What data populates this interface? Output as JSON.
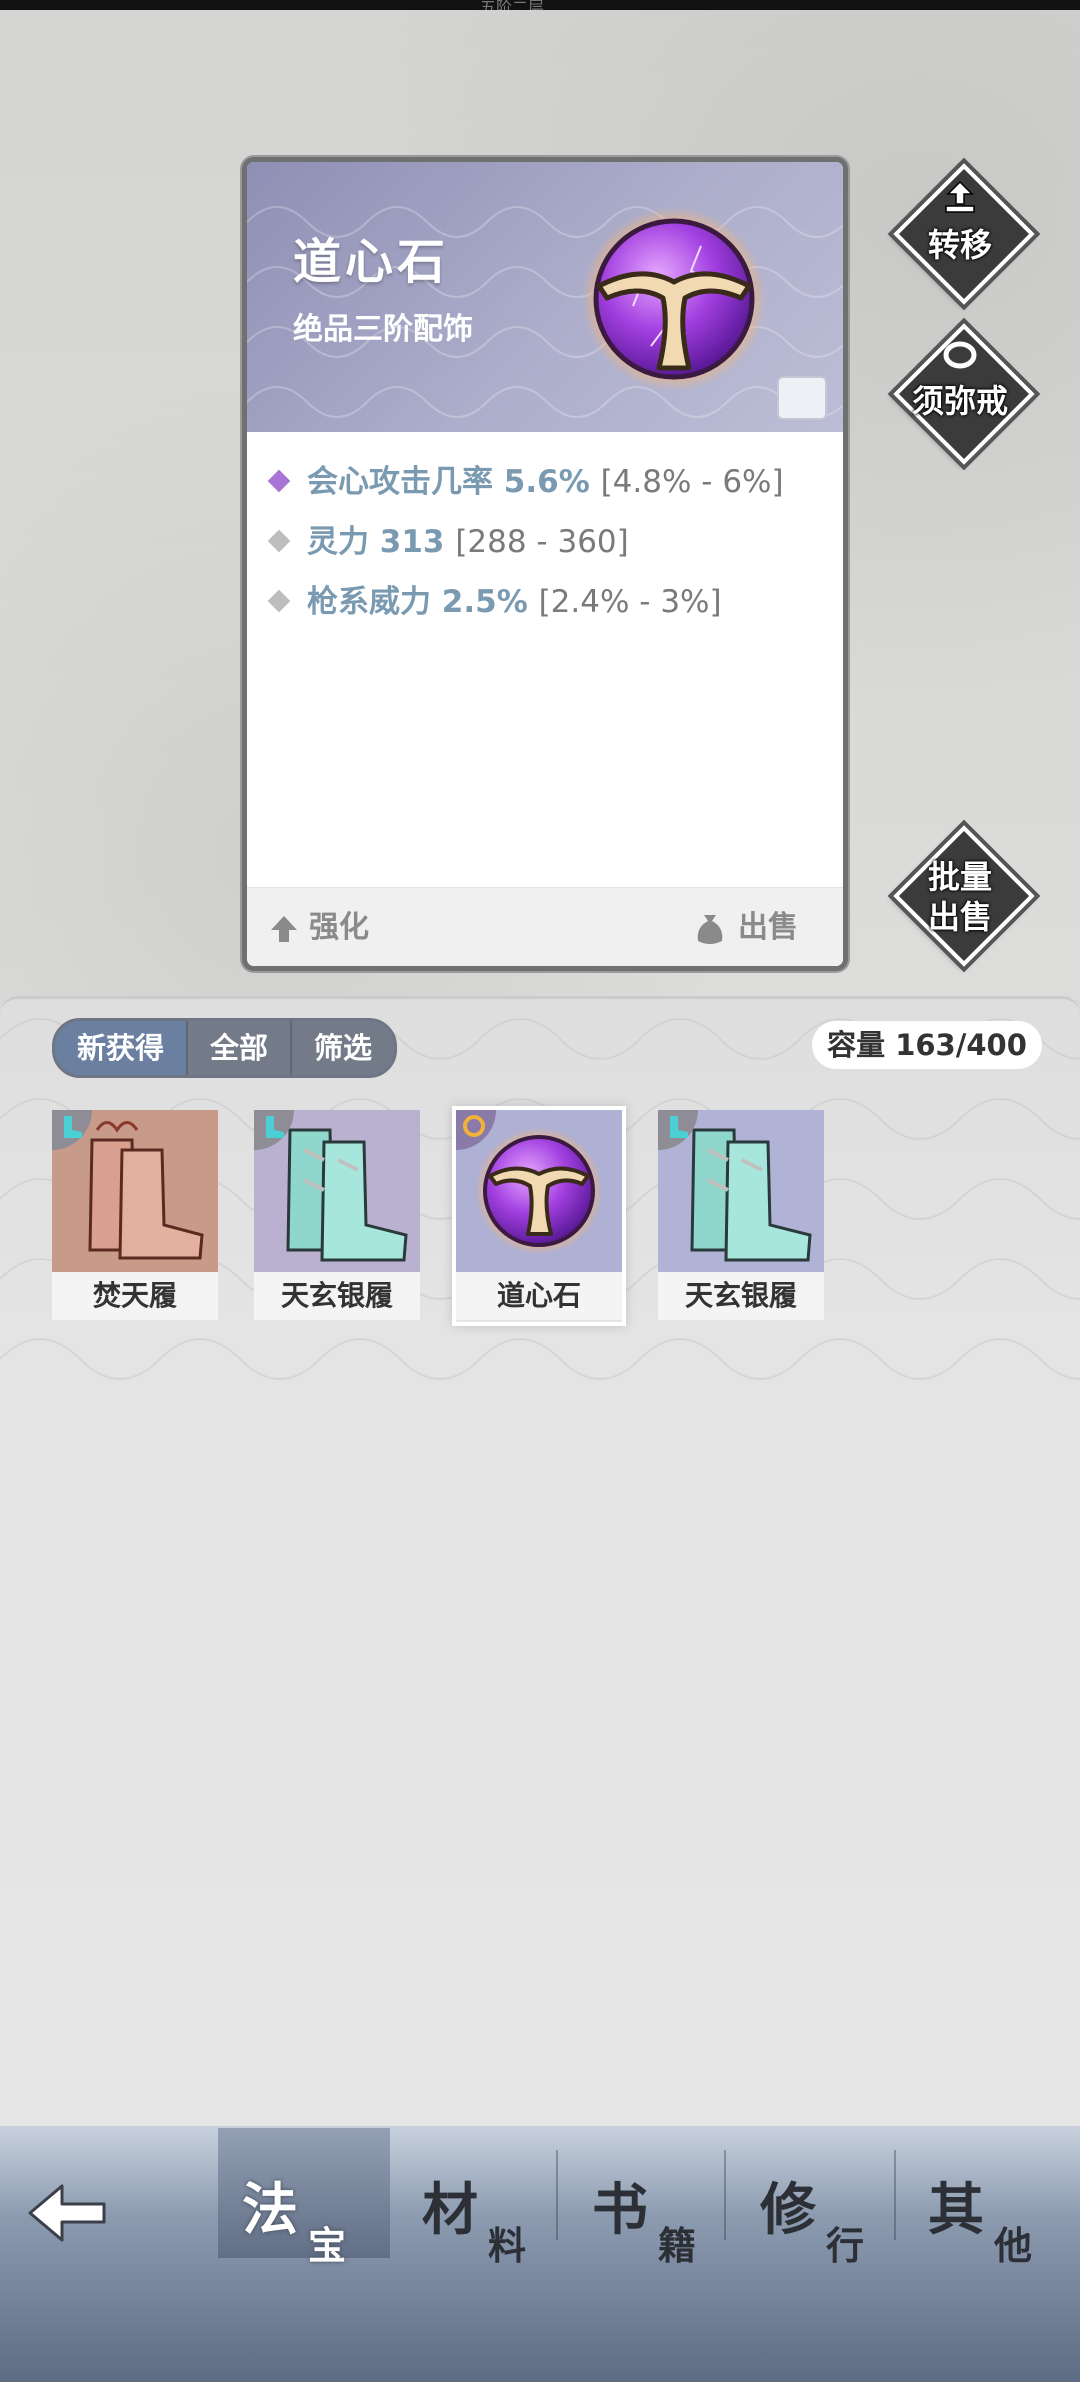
{
  "status_bar": {
    "title": "五阶二层"
  },
  "item_card": {
    "name": "道心石",
    "grade": "绝品三阶配饰",
    "stats": [
      {
        "name": "会心攻击几率",
        "value": "5.6%",
        "range": "[4.8% - 6%]",
        "color": "#a874d6"
      },
      {
        "name": "灵力",
        "value": "313",
        "range": "[288 - 360]",
        "color": "#b8b8b8"
      },
      {
        "name": "枪系威力",
        "value": "2.5%",
        "range": "[2.4% - 3%]",
        "color": "#b8b8b8"
      }
    ],
    "enhance_label": "强化",
    "sell_label": "出售"
  },
  "side_buttons": {
    "transfer": "转移",
    "storage_ring": "须弥戒",
    "batch_sell_line1": "批量",
    "batch_sell_line2": "出售"
  },
  "inventory": {
    "tabs": [
      {
        "label": "新获得",
        "active": true
      },
      {
        "label": "全部",
        "active": false
      },
      {
        "label": "筛选",
        "active": false
      }
    ],
    "capacity": "容量 163/400",
    "items": [
      {
        "name": "焚天履",
        "icon": "boots-icon",
        "bg": "#c89a8a",
        "selected": false
      },
      {
        "name": "天玄银履",
        "icon": "boots-icon",
        "bg": "#b9b1cf",
        "selected": false
      },
      {
        "name": "道心石",
        "icon": "orb-icon",
        "bg": "#aeb0d4",
        "selected": true
      },
      {
        "name": "天玄银履",
        "icon": "boots-icon",
        "bg": "#b0b3d6",
        "selected": false
      }
    ]
  },
  "bottom_nav": {
    "items": [
      {
        "big": "法",
        "small": "宝",
        "active": true
      },
      {
        "big": "材",
        "small": "料",
        "active": false
      },
      {
        "big": "书",
        "small": "籍",
        "active": false
      },
      {
        "big": "修",
        "small": "行",
        "active": false
      },
      {
        "big": "其",
        "small": "他",
        "active": false
      }
    ]
  }
}
